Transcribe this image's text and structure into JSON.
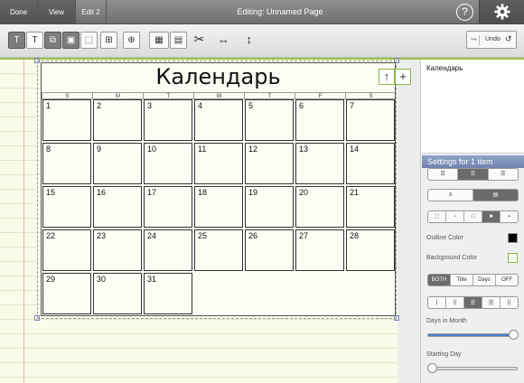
{
  "topbar": {
    "tabs": [
      {
        "label": "Done",
        "active": true
      },
      {
        "label": "View",
        "active": true
      },
      {
        "label": "Edit 2",
        "active": false
      }
    ],
    "title": "Editing: Unnamed Page",
    "help_label": "?"
  },
  "toolbar": {
    "undo_label": "Undo",
    "buttons": [
      "text-format-icon",
      "text-icon",
      "copy-icon",
      "image-icon",
      "select-icon",
      "group-icon",
      "add-icon",
      "table-icon",
      "tools-icon",
      "width-icon",
      "height-icon"
    ]
  },
  "calendar": {
    "title": "Календарь",
    "weekdays": [
      "S",
      "M",
      "T",
      "W",
      "T",
      "F",
      "S"
    ],
    "days": [
      "1",
      "2",
      "3",
      "4",
      "5",
      "6",
      "7",
      "8",
      "9",
      "10",
      "11",
      "12",
      "13",
      "14",
      "15",
      "16",
      "17",
      "18",
      "19",
      "20",
      "21",
      "22",
      "23",
      "24",
      "25",
      "26",
      "27",
      "28",
      "29",
      "30",
      "31"
    ]
  },
  "panel": {
    "selected_item": "Календарь",
    "settings_header": "Settings for 1 item",
    "outline_color_label": "Outline Color",
    "outline_color": "#000000",
    "background_color_label": "Background Color",
    "background_color": "#fdfdf4",
    "title_mode_options": [
      "BOTH",
      "Title",
      "Days",
      "OFF"
    ],
    "title_mode_selected": "BOTH",
    "days_in_month_label": "Days in Month",
    "days_in_month_level": 1.0,
    "starting_day_label": "Starting Day",
    "starting_day_level": 0.0
  },
  "colors": {
    "accent_green": "#9cc24a",
    "settings_blue": "#7a8fbb"
  }
}
